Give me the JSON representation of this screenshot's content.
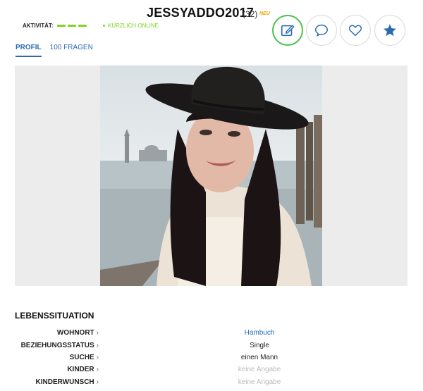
{
  "profile": {
    "username": "JESSYADDO2017",
    "age": "(32)",
    "new_badge": "NEU",
    "activity_label": "AKTIVITÄT:",
    "online_status": "KÜRZLICH ONLINE"
  },
  "actions": [
    {
      "name": "edit-note",
      "icon": "edit-icon",
      "active": true
    },
    {
      "name": "message",
      "icon": "chat-bubble-icon",
      "active": false
    },
    {
      "name": "like",
      "icon": "heart-icon",
      "active": false
    },
    {
      "name": "favorite",
      "icon": "star-icon",
      "active": false
    }
  ],
  "tabs": [
    {
      "label": "PROFIL",
      "active": true
    },
    {
      "label": "100 FRAGEN",
      "active": false
    }
  ],
  "section": {
    "title": "LEBENSSITUATION",
    "rows": [
      {
        "label": "WOHNORT",
        "value": "Hambuch"
      },
      {
        "label": "BEZIEHUNGSSTATUS",
        "value": "Single"
      },
      {
        "label": "SUCHE",
        "value": "einen Mann"
      },
      {
        "label": "KINDER",
        "value": "keine Angabe"
      },
      {
        "label": "KINDERWUNSCH",
        "value": "keine Angabe"
      }
    ]
  },
  "colors": {
    "accent": "#2b6cb0",
    "online": "#7ed321",
    "new_badge": "#f0a500",
    "active_ring": "#4cc24a"
  }
}
